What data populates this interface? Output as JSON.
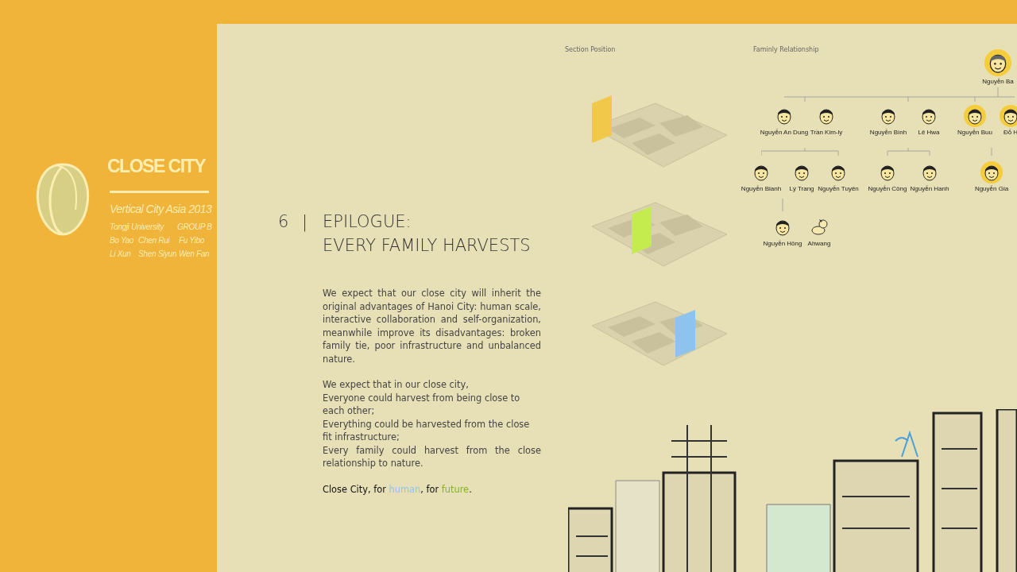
{
  "sidebar": {
    "title": "CLOSE CITY",
    "subtitle": "Vertical City Asia 2013",
    "credits": [
      [
        "Tongji University",
        "GROUP B"
      ],
      [
        "Bo Yao",
        "Chen Rui",
        "Fu Yibo"
      ],
      [
        "Li Xun",
        "Shen Siyun",
        "Wen Fan"
      ]
    ]
  },
  "chapter": {
    "number": "6",
    "divider": "|",
    "title_lines": [
      "EPILOGUE:",
      "EVERY FAMILY HARVESTS"
    ]
  },
  "paragraphs": [
    "We expect that our close city will inherit the original advantages of Hanoi City: human scale, interactive collaboration and self-organization, meanwhile improve its disadvantages: broken family tie, poor infrastructure and unbalanced nature."
  ],
  "lines": [
    "We expect that in our close city,",
    "Everyone could harvest from being close to each other;",
    "Everything could be harvested from the close fit infrastructure;",
    "Every family could harvest from the close relationship to nature."
  ],
  "closing": [
    {
      "text": "Close City, for "
    },
    {
      "text": "human",
      "color": "#8ec5ee"
    },
    {
      "text": ", for "
    },
    {
      "text": "future",
      "color": "#86b424"
    },
    {
      "text": "."
    }
  ],
  "section_position": {
    "label": "Section Position",
    "planes": [
      {
        "color": "#f2c84a"
      },
      {
        "color": "#c4ec4e"
      },
      {
        "color": "#8cc4ee"
      }
    ]
  },
  "family": {
    "label": "Faminly Relationship",
    "generations": [
      [
        {
          "name": "Nguyễn Ba",
          "highlighted": true,
          "kind": "elder"
        }
      ],
      [
        {
          "name": "Nguyễn An Dung",
          "highlighted": false,
          "kind": "person"
        },
        {
          "name": "Trần Kim-ly",
          "highlighted": false,
          "kind": "person"
        },
        {
          "name": "Nguyễn Bình",
          "highlighted": false,
          "kind": "person"
        },
        {
          "name": "Lê Hwa",
          "highlighted": false,
          "kind": "person"
        },
        {
          "name": "Nguyễn Buu",
          "highlighted": true,
          "kind": "person"
        },
        {
          "name": "Đỗ H",
          "highlighted": true,
          "kind": "person"
        }
      ],
      [
        {
          "name": "Nguyễn Bianh",
          "highlighted": false,
          "kind": "person"
        },
        {
          "name": "Lý Trang",
          "highlighted": false,
          "kind": "person"
        },
        {
          "name": "Nguyễn Tuyên",
          "highlighted": false,
          "kind": "person"
        },
        {
          "name": "Nguyễn Công",
          "highlighted": false,
          "kind": "person"
        },
        {
          "name": "Nguyễn Hanh",
          "highlighted": false,
          "kind": "person"
        },
        {
          "name": "Nguyễn Gia",
          "highlighted": true,
          "kind": "person"
        }
      ],
      [
        {
          "name": "Nguyễn Hông",
          "highlighted": false,
          "kind": "person"
        },
        {
          "name": "Ahwang",
          "highlighted": false,
          "kind": "dog"
        }
      ]
    ]
  }
}
